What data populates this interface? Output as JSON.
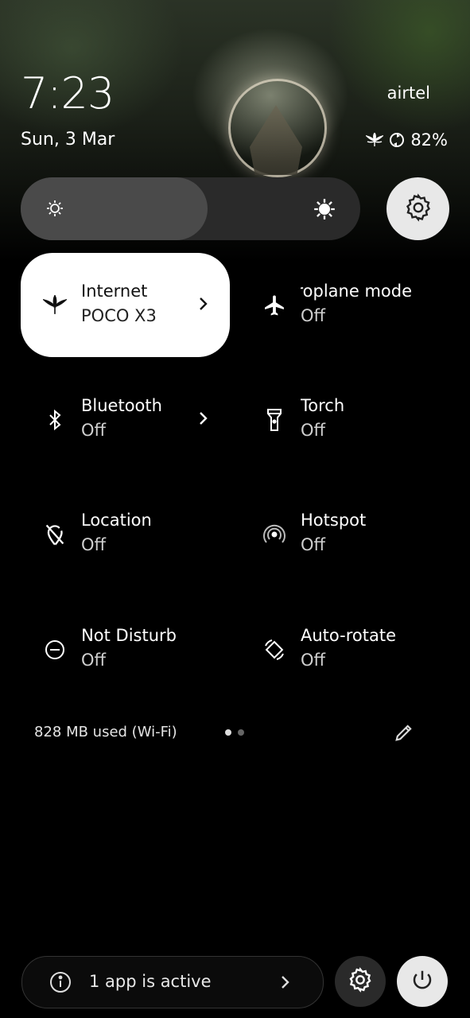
{
  "status_bar": {
    "time": "7:23",
    "date": "Sun, 3 Mar",
    "carrier": "airtel",
    "battery": "82%"
  },
  "brightness": {
    "level_fraction": 0.55
  },
  "tiles": [
    {
      "title": "Internet",
      "subtitle": "POCO X3",
      "icon": "leaf-icon",
      "active": true,
      "has_chevron": true
    },
    {
      "title": "Aeroplane mode",
      "subtitle": "Off",
      "icon": "airplane-icon",
      "active": false
    },
    {
      "title": "Bluetooth",
      "subtitle": "Off",
      "icon": "bluetooth-icon",
      "active": false,
      "has_chevron": true
    },
    {
      "title": "Torch",
      "subtitle": "Off",
      "icon": "torch-icon",
      "active": false
    },
    {
      "title": "Location",
      "subtitle": "Off",
      "icon": "location-off-icon",
      "active": false
    },
    {
      "title": "Hotspot",
      "subtitle": "Off",
      "icon": "hotspot-icon",
      "active": false
    },
    {
      "title": "Do Not Disturb",
      "subtitle": "Off",
      "icon": "dnd-icon",
      "active": false
    },
    {
      "title": "Auto-rotate",
      "subtitle": "Off",
      "icon": "rotate-icon",
      "active": false
    }
  ],
  "footer": {
    "data_usage": "828 MB used (Wi-Fi)",
    "page_dots": 2,
    "current_page": 1
  },
  "bottom_bar": {
    "active_apps": "1 app is active"
  },
  "colors": {
    "tile_active_bg": "#ffffff",
    "background": "#000000",
    "slider_track": "#2a2a2a",
    "slider_fill": "#4a4a4a"
  }
}
